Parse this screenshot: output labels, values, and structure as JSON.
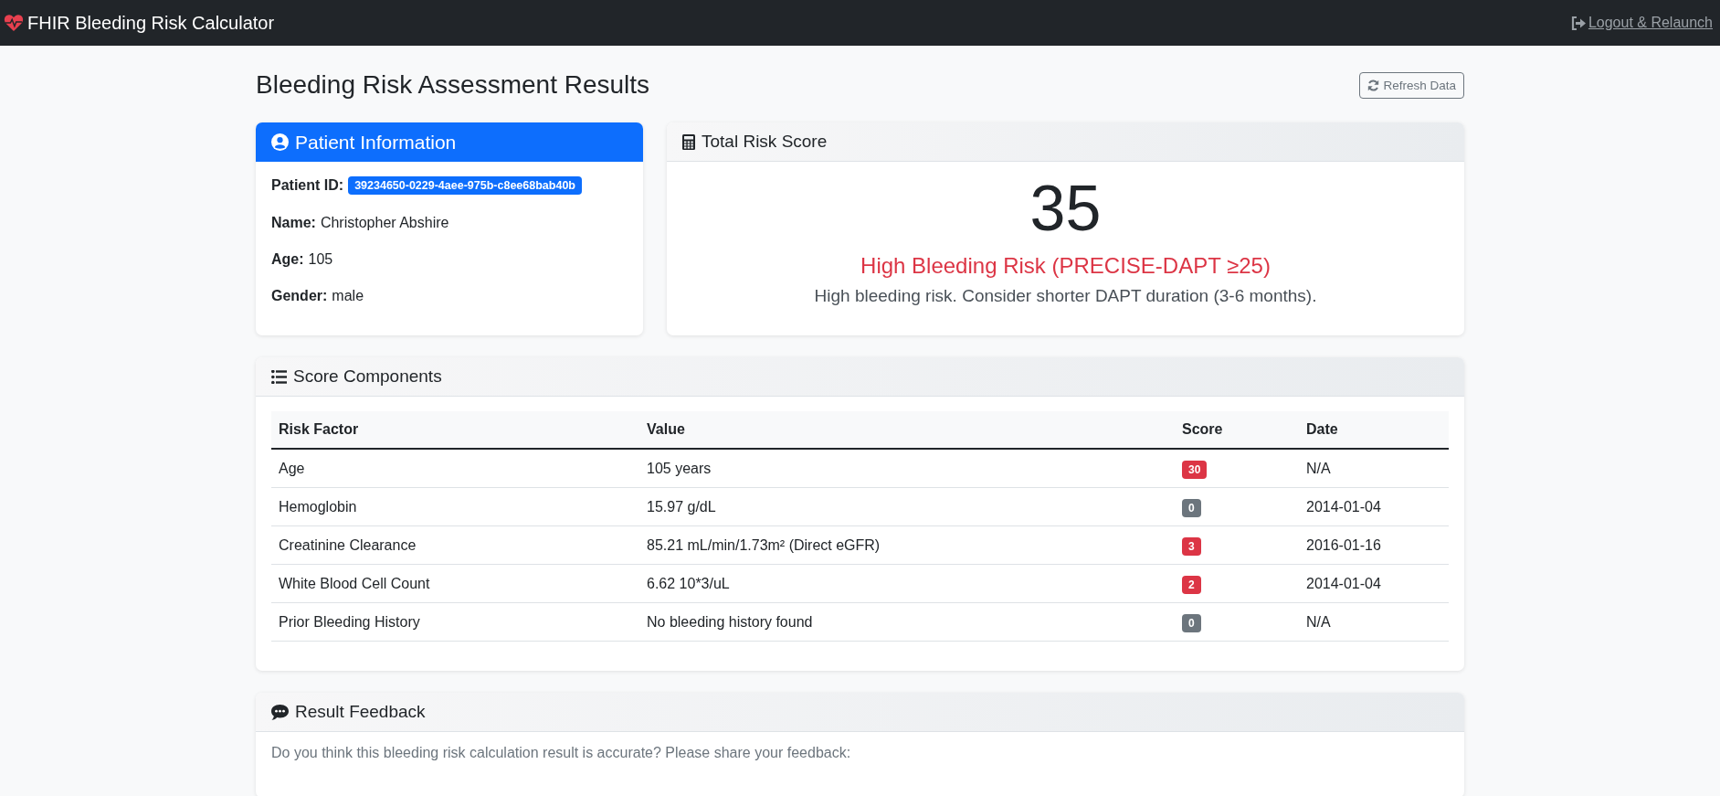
{
  "navbar": {
    "title": "FHIR Bleeding Risk Calculator",
    "logout_link": "Logout & Relaunch"
  },
  "page": {
    "title": "Bleeding Risk Assessment Results",
    "refresh_button": "Refresh Data"
  },
  "patient_card": {
    "title": "Patient Information",
    "fields": [
      {
        "label": "Patient ID:",
        "value": "39234650-0229-4aee-975b-c8ee68bab40b",
        "kind": "badge"
      },
      {
        "label": "Name:",
        "value": "Christopher Abshire",
        "kind": "text"
      },
      {
        "label": "Age:",
        "value": "105",
        "kind": "text"
      },
      {
        "label": "Gender:",
        "value": "male",
        "kind": "text"
      }
    ]
  },
  "score_card": {
    "title": "Total Risk Score",
    "score": "35",
    "risk_label": "High Bleeding Risk (PRECISE-DAPT ≥25)",
    "color": "#dc3545",
    "recommendation": "High bleeding risk. Consider shorter DAPT duration (3-6 months)."
  },
  "components_card": {
    "title": "Score Components",
    "table": {
      "columns": [
        "Risk Factor",
        "Value",
        "Score",
        "Date"
      ],
      "rows": [
        {
          "factor": "Age",
          "value": "105 years",
          "score": "30",
          "color": "#dc3545",
          "date": "N/A"
        },
        {
          "factor": "Hemoglobin",
          "value": "15.97 g/dL",
          "score": "0",
          "color": "#6c757d",
          "date": "2014-01-04"
        },
        {
          "factor": "Creatinine Clearance",
          "value": "85.21 mL/min/1.73m² (Direct eGFR)",
          "score": "3",
          "color": "#dc3545",
          "date": "2016-01-16"
        },
        {
          "factor": "White Blood Cell Count",
          "value": "6.62 10*3/uL",
          "score": "2",
          "color": "#dc3545",
          "date": "2014-01-04"
        },
        {
          "factor": "Prior Bleeding History",
          "value": "No bleeding history found",
          "score": "0",
          "color": "#6c757d",
          "date": "N/A"
        }
      ]
    }
  },
  "feedback_card": {
    "title": "Result Feedback",
    "prompt": "Do you think this bleeding risk calculation result is accurate? Please share your feedback:"
  }
}
